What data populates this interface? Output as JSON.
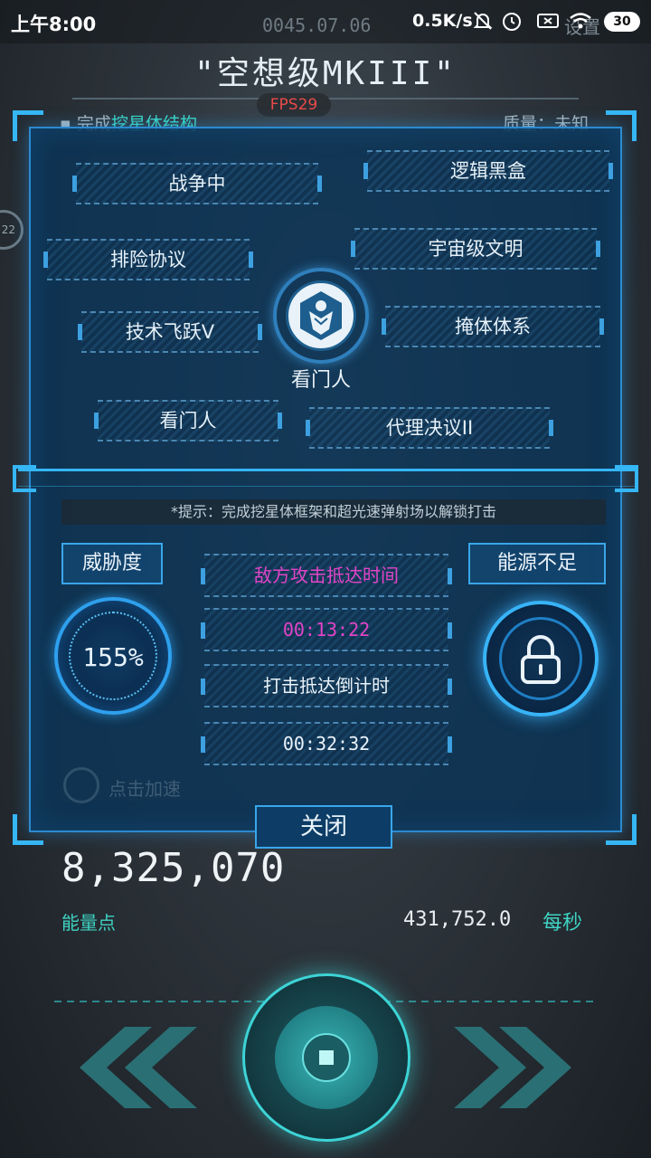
{
  "status_bar": {
    "time": "上午8:00",
    "date": "0045.07.06",
    "net_speed": "0.5K/s",
    "battery": "30",
    "settings_label": "设置"
  },
  "game": {
    "title": "\"空想级MKIII\"",
    "fps": "FPS29",
    "task_prefix": "完成",
    "task_highlight": "挖星体结构",
    "quality": "质量：未知",
    "side_badge": "22",
    "energy_value": "8,325,070",
    "energy_label": "能量点",
    "rate_value": "431,752.0",
    "rate_unit": "每秒",
    "accel_label": "点击加速"
  },
  "panel": {
    "nodes": [
      "战争中",
      "逻辑黑盒",
      "排险协议",
      "宇宙级文明",
      "技术飞跃V",
      "掩体体系",
      "看门人",
      "代理决议II"
    ],
    "center_label": "看门人",
    "hint": "*提示：完成挖星体框架和超光速弹射场以解锁打击",
    "threat_label": "威胁度",
    "threat_value": "155%",
    "energy_status": "能源不足",
    "enemy_arrival_label": "敌方攻击抵达时间",
    "enemy_arrival_time": "00:13:22",
    "strike_countdown_label": "打击抵达倒计时",
    "strike_countdown_time": "00:32:32",
    "close_label": "关闭"
  },
  "colors": {
    "accent": "#35b6f5",
    "teal": "#3fd3c3",
    "magenta": "#e244c7",
    "fps_red": "#e84a4a"
  },
  "icons": [
    "mute-icon",
    "alarm-icon",
    "sim-card-icon",
    "wifi-icon",
    "lock-icon",
    "chevron-left-icon",
    "chevron-right-icon",
    "gatekeeper-emblem-icon"
  ]
}
